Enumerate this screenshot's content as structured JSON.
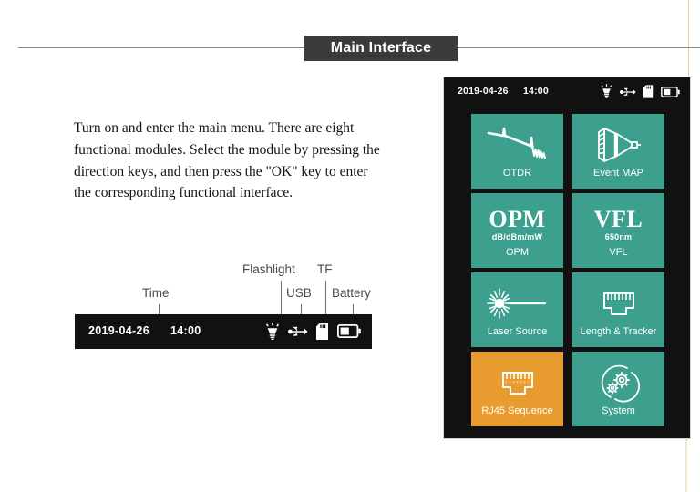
{
  "page": {
    "title": "Main Interface"
  },
  "body": {
    "paragraph": "Turn on and enter the main menu. There are eight functional modules. Select the module by pressing the direction keys, and then press the \"OK\" key to enter the corresponding functional interface."
  },
  "annotation": {
    "labels": {
      "time": "Time",
      "flashlight": "Flashlight",
      "usb": "USB",
      "tf": "TF",
      "battery": "Battery"
    },
    "statusbar": {
      "date": "2019-04-26",
      "time": "14:00",
      "icons": [
        "flashlight-icon",
        "usb-icon",
        "tf-card-icon",
        "battery-icon"
      ]
    }
  },
  "device": {
    "statusbar": {
      "date": "2019-04-26",
      "time": "14:00",
      "icons": [
        "flashlight-icon",
        "usb-icon",
        "tf-card-icon",
        "battery-icon"
      ]
    },
    "menu": {
      "tiles": [
        {
          "label": "OTDR",
          "icon": "otdr-trace-icon",
          "selected": false
        },
        {
          "label": "Event MAP",
          "icon": "event-map-icon",
          "selected": false
        },
        {
          "label": "OPM",
          "icon": "opm-text-icon",
          "big": "OPM",
          "sub": "dB/dBm/mW",
          "selected": false
        },
        {
          "label": "VFL",
          "icon": "vfl-text-icon",
          "big": "VFL",
          "sub": "650nm",
          "selected": false
        },
        {
          "label": "Laser Source",
          "icon": "laser-source-icon",
          "selected": false
        },
        {
          "label": "Length & Tracker",
          "icon": "rj45-icon",
          "selected": false
        },
        {
          "label": "RJ45 Sequence",
          "icon": "rj45-icon",
          "selected": true
        },
        {
          "label": "System",
          "icon": "gears-icon",
          "selected": false
        }
      ]
    }
  },
  "colors": {
    "tile_teal": "#3da08f",
    "tile_selected_orange": "#e89b2e",
    "screen_black": "#111111",
    "title_bar": "#3b3b3b"
  }
}
